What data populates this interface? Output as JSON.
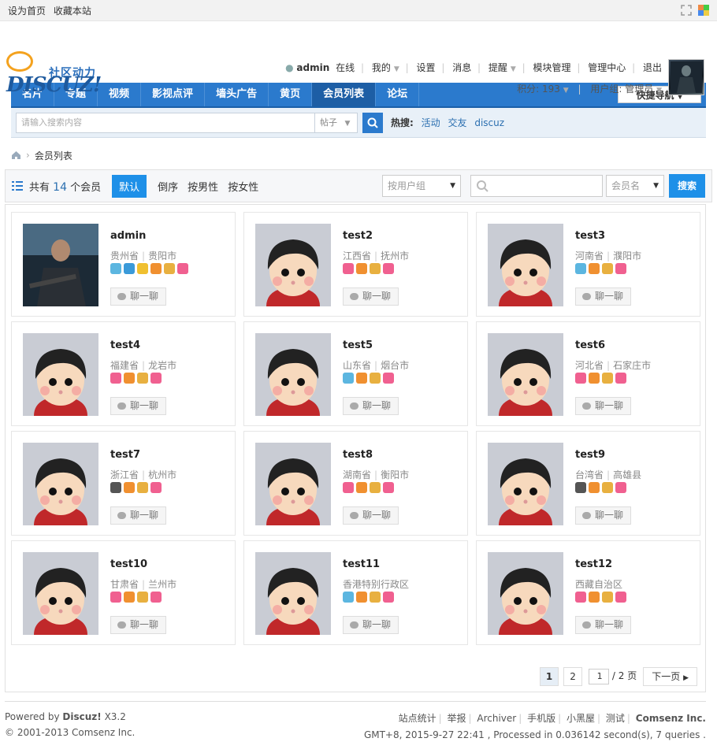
{
  "topbar": {
    "set_home": "设为首页",
    "bookmark": "收藏本站"
  },
  "logo": {
    "cn": "社区动力",
    "en": "DISCUZ!"
  },
  "user": {
    "name": "admin",
    "status": "在线",
    "my": "我的",
    "settings": "设置",
    "messages": "消息",
    "remind": "提醒",
    "module_manage": "模块管理",
    "admin_center": "管理中心",
    "logout": "退出",
    "points_label": "积分: 193",
    "group_label": "用户组: 管理员"
  },
  "nav": {
    "items": [
      {
        "label": "名片"
      },
      {
        "label": "专题"
      },
      {
        "label": "视频"
      },
      {
        "label": "影视点评"
      },
      {
        "label": "墙头广告"
      },
      {
        "label": "黄页"
      },
      {
        "label": "会员列表"
      },
      {
        "label": "论坛"
      }
    ],
    "quick_nav": "快捷导航"
  },
  "search": {
    "placeholder": "请输入搜索内容",
    "type": "帖子",
    "hot_label": "热搜:",
    "hot": [
      "活动",
      "交友",
      "discuz"
    ]
  },
  "breadcrumb": {
    "current": "会员列表"
  },
  "toolbar": {
    "total_prefix": "共有",
    "total_count": "14",
    "total_suffix": "个会员",
    "default": "默认",
    "reverse": "倒序",
    "by_male": "按男性",
    "by_female": "按女性",
    "group_select": "按用户组",
    "name_select": "会员名",
    "search_button": "搜索"
  },
  "members": [
    {
      "name": "admin",
      "province": "贵州省",
      "city": "贵阳市",
      "badges": [
        "#5cb6e0",
        "#3a9ad9",
        "#f0c030",
        "#f09030",
        "#e8b040",
        "#f06090"
      ]
    },
    {
      "name": "test2",
      "province": "江西省",
      "city": "抚州市",
      "badges": [
        "#f06090",
        "#f09030",
        "#e8b040",
        "#f06090"
      ]
    },
    {
      "name": "test3",
      "province": "河南省",
      "city": "濮阳市",
      "badges": [
        "#5cb6e0",
        "#f09030",
        "#e8b040",
        "#f06090"
      ]
    },
    {
      "name": "test4",
      "province": "福建省",
      "city": "龙岩市",
      "badges": [
        "#f06090",
        "#f09030",
        "#e8b040",
        "#f06090"
      ]
    },
    {
      "name": "test5",
      "province": "山东省",
      "city": "烟台市",
      "badges": [
        "#5cb6e0",
        "#f09030",
        "#e8b040",
        "#f06090"
      ]
    },
    {
      "name": "test6",
      "province": "河北省",
      "city": "石家庄市",
      "badges": [
        "#f06090",
        "#f09030",
        "#e8b040",
        "#f06090"
      ]
    },
    {
      "name": "test7",
      "province": "浙江省",
      "city": "杭州市",
      "badges": [
        "#555555",
        "#f09030",
        "#e8b040",
        "#f06090"
      ]
    },
    {
      "name": "test8",
      "province": "湖南省",
      "city": "衡阳市",
      "badges": [
        "#f06090",
        "#f09030",
        "#e8b040",
        "#f06090"
      ]
    },
    {
      "name": "test9",
      "province": "台湾省",
      "city": "高雄县",
      "badges": [
        "#555555",
        "#f09030",
        "#e8b040",
        "#f06090"
      ]
    },
    {
      "name": "test10",
      "province": "甘肃省",
      "city": "兰州市",
      "badges": [
        "#f06090",
        "#f09030",
        "#e8b040",
        "#f06090"
      ]
    },
    {
      "name": "test11",
      "province": "香港特别行政区",
      "city": "",
      "badges": [
        "#5cb6e0",
        "#f09030",
        "#e8b040",
        "#f06090"
      ]
    },
    {
      "name": "test12",
      "province": "西藏自治区",
      "city": "",
      "badges": [
        "#f06090",
        "#f09030",
        "#e8b040",
        "#f06090"
      ]
    }
  ],
  "chat_label": "聊一聊",
  "pager": {
    "page1": "1",
    "page2": "2",
    "input": "1",
    "total": "/ 2 页",
    "next": "下一页"
  },
  "footer": {
    "powered_prefix": "Powered by",
    "powered_brand": "Discuz!",
    "powered_version": "X3.2",
    "copyright": "© 2001-2013 Comsenz Inc.",
    "links": [
      "站点统计",
      "举报",
      "Archiver",
      "手机版",
      "小黑屋",
      "测试"
    ],
    "company": "Comsenz Inc.",
    "stats": "GMT+8, 2015-9-27 22:41 , Processed in 0.036142 second(s), 7 queries ."
  },
  "colors": {
    "nav_blue": "#2b7acd",
    "button_blue": "#1e90e8",
    "link_blue": "#2b6fb0"
  }
}
